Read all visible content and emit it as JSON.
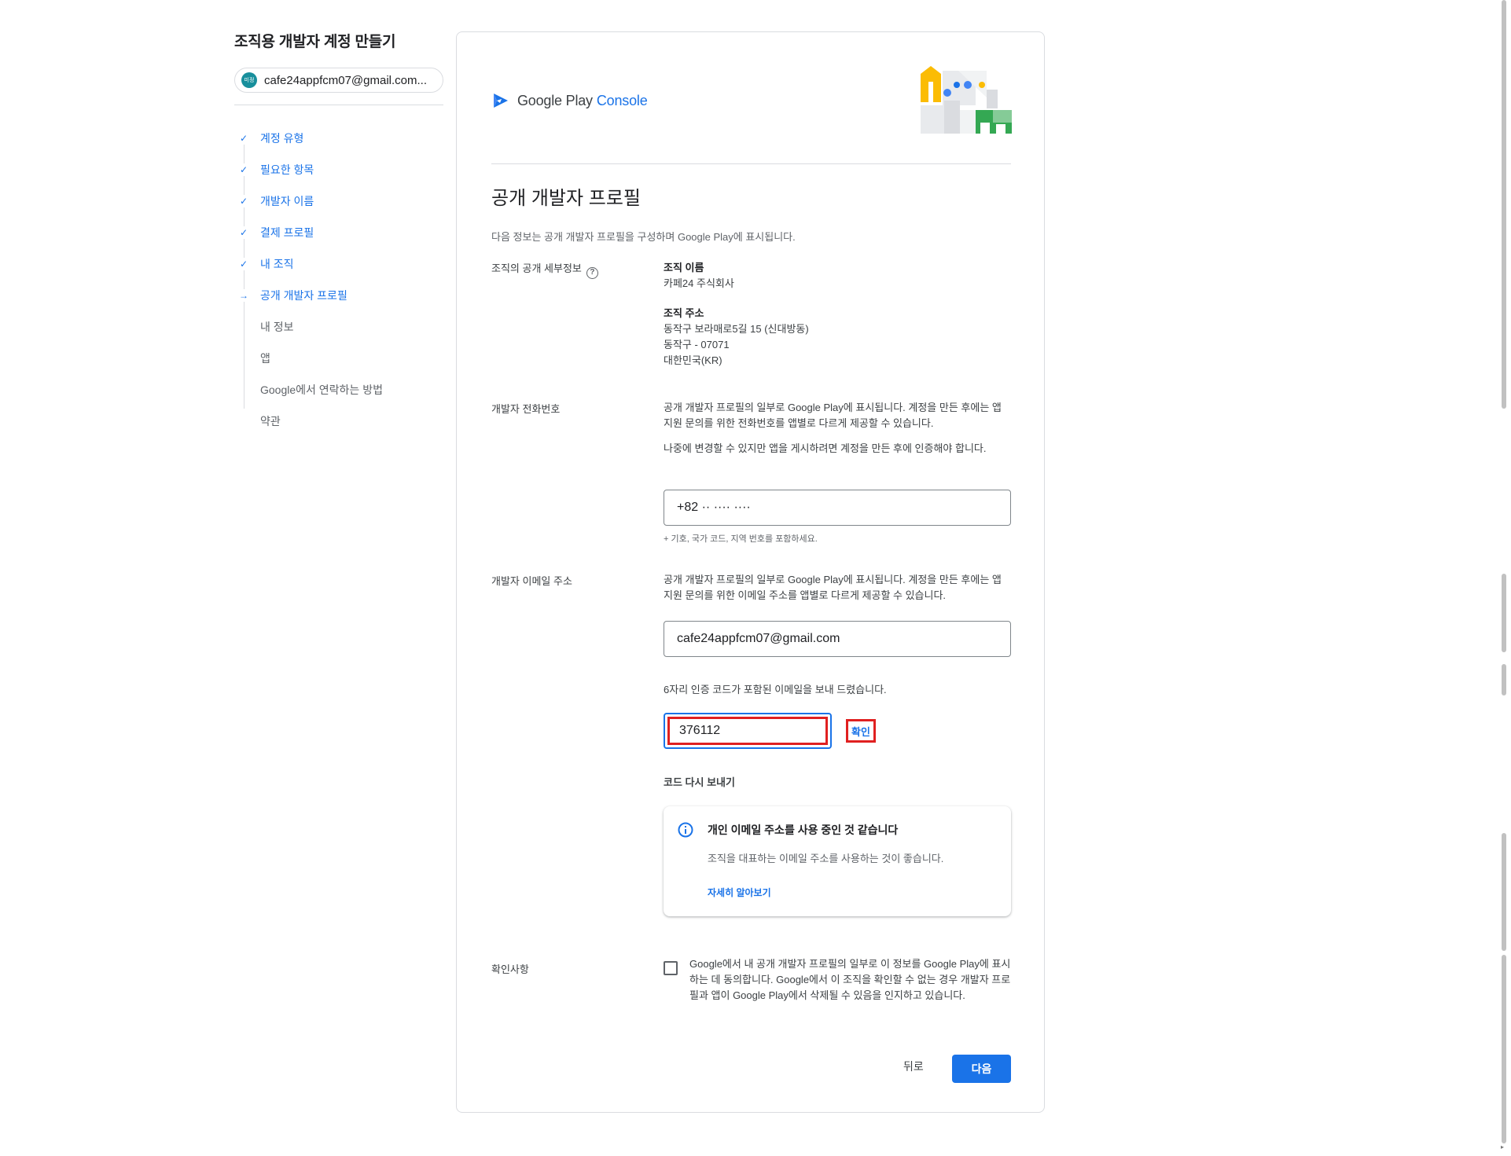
{
  "rail": {
    "title": "조직용 개발자 계정 만들기",
    "avatar_text": "미정",
    "account_email": "cafe24appfcm07@gmail.com...",
    "steps": [
      {
        "label": "계정 유형",
        "state": "done"
      },
      {
        "label": "필요한 항목",
        "state": "done"
      },
      {
        "label": "개발자 이름",
        "state": "done"
      },
      {
        "label": "결제 프로필",
        "state": "done"
      },
      {
        "label": "내 조직",
        "state": "done"
      },
      {
        "label": "공개 개발자 프로필",
        "state": "current"
      },
      {
        "label": "내 정보",
        "state": "todo"
      },
      {
        "label": "앱",
        "state": "todo"
      },
      {
        "label": "Google에서 연락하는 방법",
        "state": "todo"
      },
      {
        "label": "약관",
        "state": "todo"
      }
    ],
    "done_mark": "✓",
    "current_mark": "→"
  },
  "brand": {
    "google_play": "Google Play",
    "console": "Console"
  },
  "main": {
    "title": "공개 개발자 프로필",
    "description": "다음 정보는 공개 개발자 프로필을 구성하며 Google Play에 표시됩니다.",
    "org_section": {
      "label": "조직의 공개 세부정보",
      "help_icon": "?",
      "name_heading": "조직 이름",
      "name_value": "카페24 주식회사",
      "address_heading": "조직 주소",
      "address_lines": [
        "동작구 보라매로5길 15 (신대방동)",
        "동작구 - 07071",
        "대한민국(KR)"
      ]
    },
    "phone_section": {
      "label": "개발자 전화번호",
      "desc1": "공개 개발자 프로필의 일부로 Google Play에 표시됩니다. 계정을 만든 후에는 앱 지원 문의를 위한 전화번호를 앱별로 다르게 제공할 수 있습니다.",
      "desc2": "나중에 변경할 수 있지만 앱을 게시하려면 계정을 만든 후에 인증해야 합니다.",
      "value": "+82 ·· ···· ····",
      "hint": "+ 기호, 국가 코드, 지역 번호를 포함하세요."
    },
    "email_section": {
      "label": "개발자 이메일 주소",
      "desc": "공개 개발자 프로필의 일부로 Google Play에 표시됩니다. 계정을 만든 후에는 앱 지원 문의를 위한 이메일 주소를 앱별로 다르게 제공할 수 있습니다.",
      "value": "cafe24appfcm07@gmail.com",
      "code_sent_msg": "6자리 인증 코드가 포함된 이메일을 보내 드렸습니다.",
      "code_value": "376112",
      "verify_label": "확인",
      "resend_label": "코드 다시 보내기"
    },
    "notice": {
      "title": "개인 이메일 주소를 사용 중인 것 같습니다",
      "body": "조직을 대표하는 이메일 주소를 사용하는 것이 좋습니다.",
      "link": "자세히 알아보기"
    },
    "consent": {
      "label": "확인사항",
      "text": "Google에서 내 공개 개발자 프로필의 일부로 이 정보를 Google Play에 표시하는 데 동의합니다. Google에서 이 조직을 확인할 수 없는 경우 개발자 프로필과 앱이 Google Play에서 삭제될 수 있음을 인지하고 있습니다."
    },
    "back_label": "뒤로",
    "next_label": "다음"
  },
  "colors": {
    "accent": "#1a73e8",
    "highlight": "#e02020",
    "avatar": "#188f9c"
  }
}
